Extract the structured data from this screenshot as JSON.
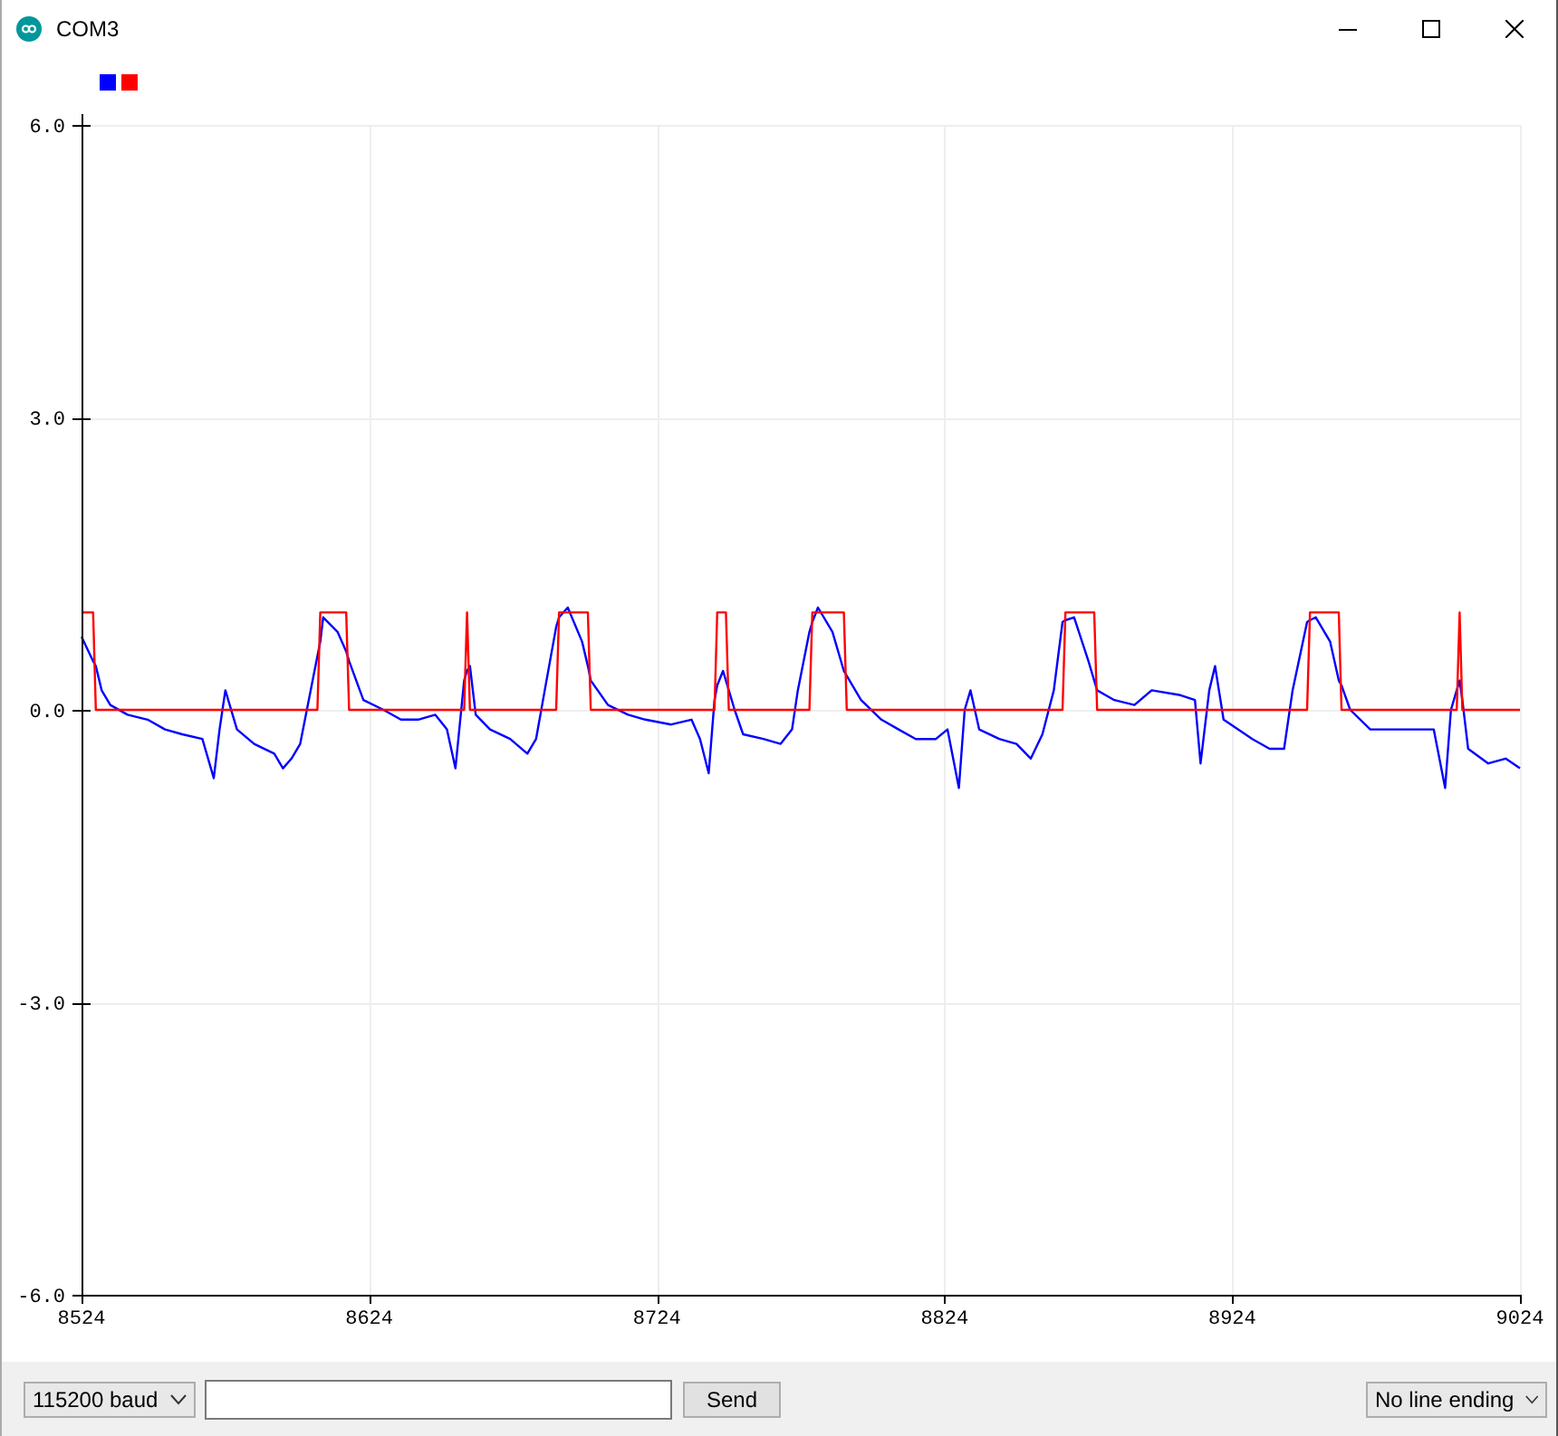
{
  "window": {
    "title": "COM3"
  },
  "plot": {
    "chart_data": {
      "type": "line",
      "grid": true,
      "xlim": [
        8524,
        9024
      ],
      "ylim": [
        -6,
        6
      ],
      "xticks": [
        8524,
        8624,
        8724,
        8824,
        8924,
        9024
      ],
      "yticks": [
        {
          "value": 6,
          "label": "6.0"
        },
        {
          "value": 3,
          "label": "3.0"
        },
        {
          "value": 0,
          "label": "0.0"
        },
        {
          "value": -3,
          "label": "-3.0"
        },
        {
          "value": -6,
          "label": "-6.0"
        }
      ],
      "x": [
        8524,
        8528,
        8529,
        8531,
        8534,
        8540,
        8547,
        8553,
        8559,
        8566,
        8570,
        8572,
        8574,
        8578,
        8584,
        8591,
        8594,
        8597,
        8600,
        8605,
        8606,
        8607,
        8608,
        8613,
        8616,
        8617,
        8622,
        8629,
        8635,
        8641,
        8647,
        8651,
        8654,
        8657,
        8658,
        8659,
        8661,
        8666,
        8673,
        8679,
        8682,
        8685,
        8689,
        8690,
        8693,
        8698,
        8700,
        8701,
        8707,
        8714,
        8720,
        8729,
        8736,
        8739,
        8742,
        8744,
        8745,
        8747,
        8748,
        8749,
        8751,
        8754,
        8761,
        8767,
        8771,
        8773,
        8777,
        8778,
        8780,
        8785,
        8789,
        8790,
        8795,
        8802,
        8808,
        8814,
        8821,
        8825,
        8829,
        8831,
        8833,
        8836,
        8843,
        8849,
        8854,
        8858,
        8862,
        8865,
        8866,
        8869,
        8874,
        8876,
        8877,
        8883,
        8890,
        8896,
        8906,
        8911,
        8913,
        8916,
        8918,
        8921,
        8931,
        8937,
        8942,
        8945,
        8950,
        8951,
        8953,
        8958,
        8961,
        8962,
        8965,
        8972,
        8981,
        8994,
        8998,
        9000,
        9002,
        9003,
        9004,
        9006,
        9013,
        9019,
        9024
      ],
      "series": [
        {
          "color": "#0000ff",
          "values": [
            0.75,
            0.5,
            0.45,
            0.2,
            0.05,
            -0.05,
            -0.1,
            -0.2,
            -0.25,
            -0.3,
            -0.7,
            -0.2,
            0.2,
            -0.2,
            -0.35,
            -0.45,
            -0.6,
            -0.5,
            -0.35,
            0.4,
            0.55,
            0.7,
            0.95,
            0.8,
            0.6,
            0.5,
            0.1,
            0,
            -0.1,
            -0.1,
            -0.05,
            -0.2,
            -0.6,
            0.3,
            0.4,
            0.45,
            -0.05,
            -0.2,
            -0.3,
            -0.45,
            -0.3,
            0.2,
            0.85,
            0.95,
            1.05,
            0.7,
            0.45,
            0.3,
            0.05,
            -0.05,
            -0.1,
            -0.15,
            -0.1,
            -0.3,
            -0.65,
            0.1,
            0.25,
            0.4,
            0.3,
            0.2,
            0,
            -0.25,
            -0.3,
            -0.35,
            -0.2,
            0.2,
            0.8,
            0.9,
            1.05,
            0.8,
            0.4,
            0.35,
            0.1,
            -0.1,
            -0.2,
            -0.3,
            -0.3,
            -0.2,
            -0.8,
            0,
            0.2,
            -0.2,
            -0.3,
            -0.35,
            -0.5,
            -0.25,
            0.2,
            0.9,
            0.92,
            0.95,
            0.5,
            0.3,
            0.2,
            0.1,
            0.05,
            0.2,
            0.15,
            0.1,
            -0.55,
            0.2,
            0.45,
            -0.1,
            -0.3,
            -0.4,
            -0.4,
            0.2,
            0.9,
            0.92,
            0.95,
            0.7,
            0.3,
            0.25,
            0,
            -0.2,
            -0.2,
            -0.2,
            -0.8,
            0,
            0.2,
            0.3,
            0.1,
            -0.4,
            -0.55,
            -0.5,
            -0.6
          ]
        },
        {
          "color": "#ff0000",
          "values": [
            1,
            1,
            0,
            0,
            0,
            0,
            0,
            0,
            0,
            0,
            0,
            0,
            0,
            0,
            0,
            0,
            0,
            0,
            0,
            0,
            0,
            1,
            1,
            1,
            1,
            0,
            0,
            0,
            0,
            0,
            0,
            0,
            0,
            0,
            1,
            0,
            0,
            0,
            0,
            0,
            0,
            0,
            0,
            1,
            1,
            1,
            1,
            0,
            0,
            0,
            0,
            0,
            0,
            0,
            0,
            0,
            1,
            1,
            1,
            0,
            0,
            0,
            0,
            0,
            0,
            0,
            0,
            1,
            1,
            1,
            1,
            0,
            0,
            0,
            0,
            0,
            0,
            0,
            0,
            0,
            0,
            0,
            0,
            0,
            0,
            0,
            0,
            0,
            1,
            1,
            1,
            1,
            0,
            0,
            0,
            0,
            0,
            0,
            0,
            0,
            0,
            0,
            0,
            0,
            0,
            0,
            0,
            1,
            1,
            1,
            1,
            0,
            0,
            0,
            0,
            0,
            0,
            0,
            0,
            1,
            0,
            0,
            0,
            0,
            0
          ]
        }
      ]
    }
  },
  "footer": {
    "baud_select": {
      "value": "115200 baud"
    },
    "send_button": {
      "label": "Send"
    },
    "line_ending_select": {
      "value": "No line ending"
    }
  }
}
